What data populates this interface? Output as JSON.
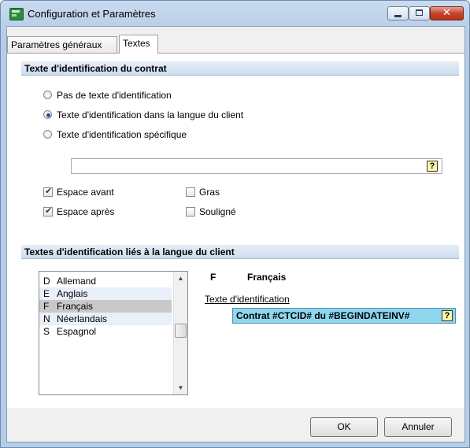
{
  "window": {
    "title": "Configuration et Paramètres",
    "close_glyph": "✕"
  },
  "tabs": [
    {
      "label": "Paramètres généraux",
      "selected": false
    },
    {
      "label": "Textes",
      "selected": true
    }
  ],
  "section_identification": {
    "header": "Texte d'identification du contrat",
    "radios": [
      {
        "label": "Pas de texte d'identification",
        "checked": false
      },
      {
        "label": "Texte d'identification dans la langue du client",
        "checked": true
      },
      {
        "label": "Texte d'identification spécifique",
        "checked": false
      }
    ],
    "specific_text_value": "",
    "help_glyph": "?",
    "options": [
      {
        "label": "Espace avant",
        "checked": true
      },
      {
        "label": "Gras",
        "checked": false
      },
      {
        "label": "Espace après",
        "checked": true
      },
      {
        "label": "Souligné",
        "checked": false
      }
    ],
    "check_glyph": "✔"
  },
  "section_languages": {
    "header": "Textes d'identification liés à la langue du client",
    "languages": [
      {
        "code": "D",
        "name": "Allemand",
        "state": "normal"
      },
      {
        "code": "E",
        "name": "Anglais",
        "state": "alt"
      },
      {
        "code": "F",
        "name": "Français",
        "state": "selected"
      },
      {
        "code": "N",
        "name": "Néerlandais",
        "state": "alt"
      },
      {
        "code": "S",
        "name": "Espagnol",
        "state": "normal"
      }
    ],
    "scroll_up_glyph": "▲",
    "scroll_down_glyph": "▼",
    "detail": {
      "code": "F",
      "name": "Français",
      "field_label": "Texte d'identification",
      "value": "Contrat #CTCID# du #BEGINDATEINV#"
    }
  },
  "footer": {
    "ok_label": "OK",
    "cancel_label": "Annuler"
  },
  "colors": {
    "selected_row": "#c9c9c9",
    "alt_row": "#eaf0fa",
    "highlight_field": "#8fd6ef"
  }
}
